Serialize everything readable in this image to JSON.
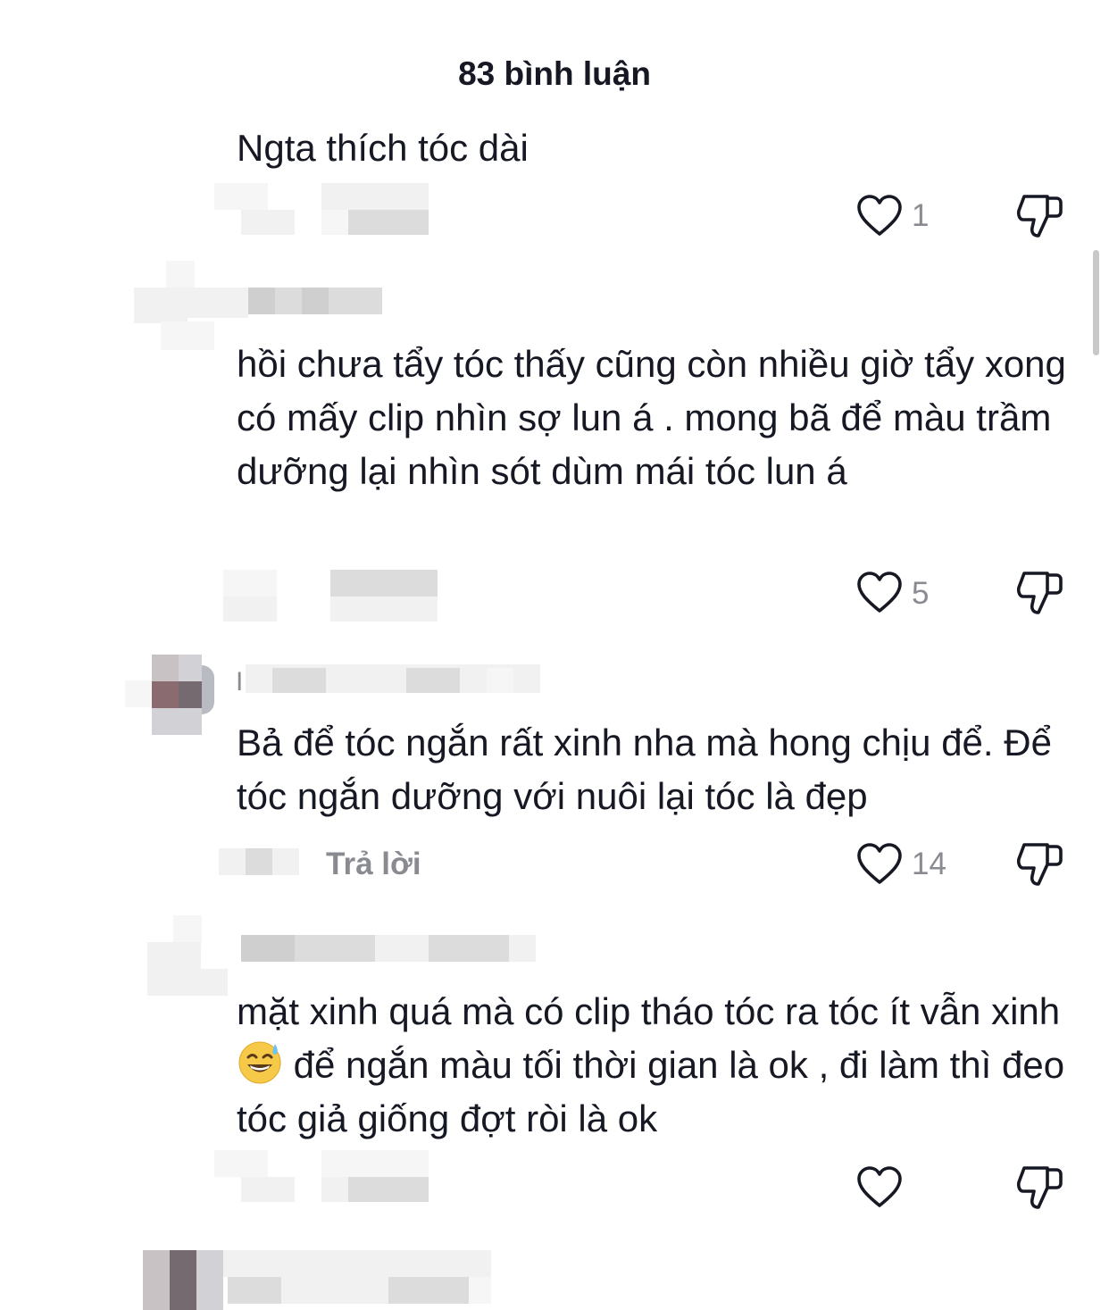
{
  "header": {
    "title": "83 bình luận"
  },
  "comments": [
    {
      "text": "Ngta thích tóc dài",
      "likes": "1",
      "reply": ""
    },
    {
      "text": "hồi chưa tẩy tóc thấy cũng còn nhiều giờ tẩy xong có mấy clip nhìn sợ lun á . mong bã để màu trầm dưỡng lại nhìn sót dùm mái tóc lun á",
      "likes": "5",
      "reply": ""
    },
    {
      "text": "Bả để tóc ngắn rất xinh nha mà hong chịu để. Để tóc ngắn dưỡng với nuôi lại tóc là đẹp",
      "likes": "14",
      "reply": "Trả lời",
      "username_visible": "I"
    },
    {
      "text_before_emoji": "mặt xinh quá mà có clip tháo tóc ra tóc ít vẫn xinh ",
      "emoji": "sweat-smile-emoji",
      "text_after_emoji": " để ngắn màu tối thời gian là ok , đi làm thì đeo tóc giả giống đợt ròi là ok",
      "likes": "",
      "reply": ""
    }
  ],
  "icons": {
    "like": "heart-outline-icon",
    "dislike": "thumbs-down-outline-icon"
  },
  "colors": {
    "text": "#161823",
    "muted": "#8a8b91",
    "icon": "#161823"
  }
}
